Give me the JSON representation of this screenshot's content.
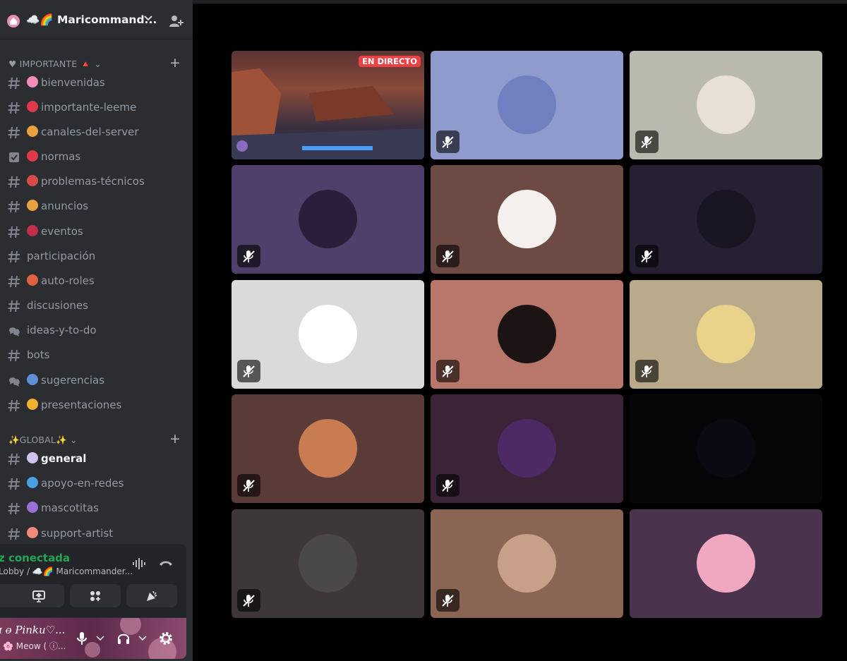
{
  "server": {
    "name": "☁️🌈 Maricommand...",
    "colors": {
      "sidebar": "#2b2d31",
      "connected": "#23a559",
      "live": "#ed4245"
    }
  },
  "categories": [
    {
      "label": "♥ IMPORTANTE 🔺 ⌄"
    },
    {
      "label": "✨GLOBAL✨ ⌄"
    }
  ],
  "channels": [
    {
      "name": "bienvenidas",
      "icon": "text-channel-icon"
    },
    {
      "name": "importante-leeme",
      "icon": "text-channel-icon"
    },
    {
      "name": "canales-del-server",
      "icon": "text-channel-icon"
    },
    {
      "name": "normas",
      "icon": "rules-channel-icon"
    },
    {
      "name": "problemas-técnicos",
      "icon": "text-channel-icon"
    },
    {
      "name": "anuncios",
      "icon": "text-channel-icon"
    },
    {
      "name": "eventos",
      "icon": "text-channel-icon"
    },
    {
      "name": "participación",
      "icon": "text-channel-icon"
    },
    {
      "name": "auto-roles",
      "icon": "text-channel-icon"
    },
    {
      "name": "discusiones",
      "icon": "text-channel-icon"
    },
    {
      "name": "ideas-y-to-do",
      "icon": "forum-channel-icon"
    },
    {
      "name": "bots",
      "icon": "text-channel-icon"
    },
    {
      "name": "sugerencias",
      "icon": "forum-channel-icon"
    },
    {
      "name": "presentaciones",
      "icon": "text-channel-icon"
    },
    {
      "name": "general",
      "icon": "text-channel-icon"
    },
    {
      "name": "apoyo-en-redes",
      "icon": "text-channel-icon"
    },
    {
      "name": "mascotitas",
      "icon": "text-channel-icon"
    },
    {
      "name": "support-artist",
      "icon": "text-channel-icon"
    }
  ],
  "voice": {
    "status": "z conectada",
    "location": "Lobby / ☁️🌈 Maricommander..."
  },
  "user": {
    "name": "ɪ ɵ Pinku♡...",
    "status": "🌸 Meow ( ⓘ..."
  },
  "tiles": [
    {
      "live_label": "EN DIRECTO",
      "bg": "#3a2a2a"
    },
    {
      "bg": "#8f9bcc"
    },
    {
      "bg": "#b9b9ad"
    },
    {
      "bg": "#4f3f6a"
    },
    {
      "bg": "#6d4a44"
    },
    {
      "bg": "#272032"
    },
    {
      "bg": "#dadada"
    },
    {
      "bg": "#b9776b"
    },
    {
      "bg": "#b9aa8b"
    },
    {
      "bg": "#5a3b38"
    },
    {
      "bg": "#3b2338"
    },
    {
      "bg": "#050608"
    },
    {
      "bg": "#3d3737"
    },
    {
      "bg": "#8a6553"
    },
    {
      "bg": "#4a334c"
    }
  ]
}
